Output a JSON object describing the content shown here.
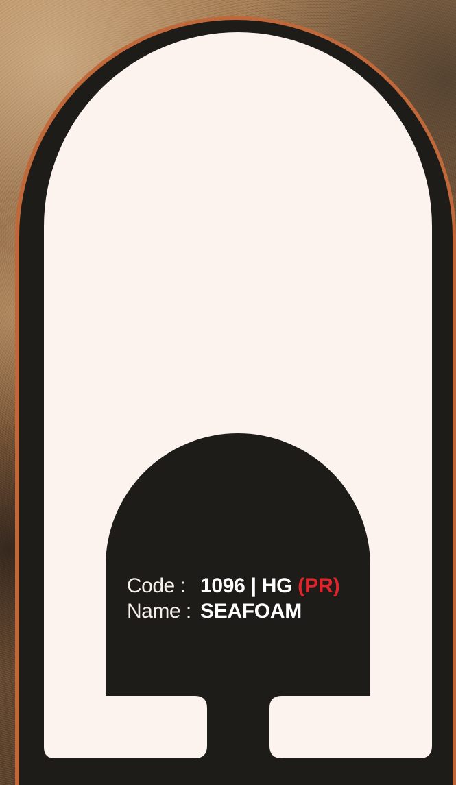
{
  "label": {
    "code_key": "Code :",
    "code_value": "1096 | HG",
    "code_tag": "(PR)",
    "name_key": "Name :",
    "name_value": "SEAFOAM"
  },
  "colors": {
    "outer_rim": "#c0683a",
    "frame": "#1d1c19",
    "panel": "#fcf3ee",
    "tag": "#e0242c"
  }
}
